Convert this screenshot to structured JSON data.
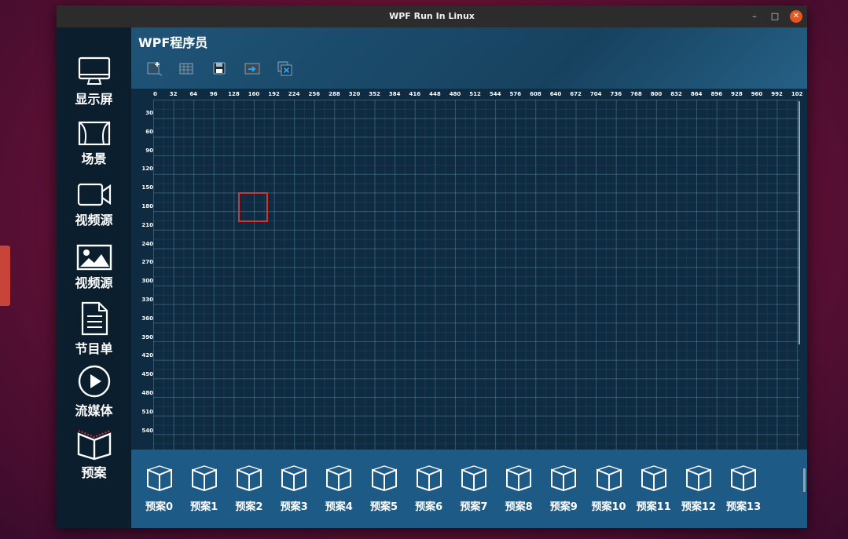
{
  "window": {
    "title": "WPF Run In Linux",
    "controls": {
      "minimize": "–",
      "maximize": "□",
      "close": "✕"
    }
  },
  "header": {
    "title": "WPF程序员"
  },
  "sidebar": {
    "items": [
      {
        "label": "显示屏",
        "icon": "monitor-icon"
      },
      {
        "label": "场景",
        "icon": "scene-icon"
      },
      {
        "label": "视频源",
        "icon": "video-camera-icon"
      },
      {
        "label": "视频源",
        "icon": "image-icon"
      },
      {
        "label": "节目单",
        "icon": "document-icon"
      },
      {
        "label": "流媒体",
        "icon": "play-icon"
      },
      {
        "label": "预案",
        "icon": "book-icon"
      }
    ]
  },
  "toolbar": {
    "icons": [
      "add-screen-icon",
      "grid-icon",
      "save-icon",
      "export-icon",
      "close-all-icon"
    ]
  },
  "rulers": {
    "top": [
      "0",
      "32",
      "64",
      "96",
      "128",
      "160",
      "192",
      "224",
      "256",
      "288",
      "320",
      "352",
      "384",
      "416",
      "448",
      "480",
      "512",
      "544",
      "576",
      "608",
      "640",
      "672",
      "704",
      "736",
      "768",
      "800",
      "832",
      "864",
      "896",
      "928",
      "960",
      "992",
      "102"
    ],
    "left": [
      "30",
      "60",
      "90",
      "120",
      "150",
      "180",
      "210",
      "240",
      "270",
      "300",
      "330",
      "360",
      "390",
      "420",
      "450",
      "480",
      "510",
      "540"
    ]
  },
  "plans": {
    "items": [
      "预案0",
      "预案1",
      "预案2",
      "预案3",
      "预案4",
      "预案5",
      "预案6",
      "预案7",
      "预案8",
      "预案9",
      "预案10",
      "预案11",
      "预案12",
      "预案13"
    ]
  },
  "colors": {
    "accent": "#e95420",
    "selection": "#e0302c",
    "plan_bar": "#1e5a86",
    "canvas": "#0e2b42"
  }
}
